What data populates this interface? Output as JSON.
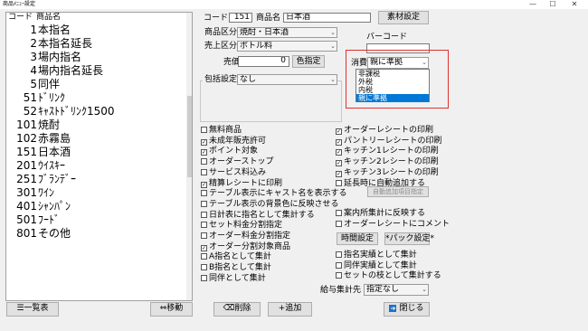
{
  "window": {
    "title": "商品ﾒﾆｭｰ設定",
    "min": "—",
    "max": "☐",
    "close": "✕"
  },
  "list": {
    "header_code": "コード",
    "header_name": "商品名",
    "rows": [
      {
        "code": "1",
        "name": "本指名"
      },
      {
        "code": "2",
        "name": "本指名延長"
      },
      {
        "code": "3",
        "name": "場内指名"
      },
      {
        "code": "4",
        "name": "場内指名延長"
      },
      {
        "code": "5",
        "name": "同伴"
      },
      {
        "code": "51",
        "name": "ﾄﾞﾘﾝｸ"
      },
      {
        "code": "52",
        "name": "ｷｬｽﾄﾄﾞﾘﾝｸ1500"
      },
      {
        "code": "101",
        "name": "焼酎"
      },
      {
        "code": "102",
        "name": "赤霧島"
      },
      {
        "code": "151",
        "name": "日本酒"
      },
      {
        "code": "201",
        "name": "ｳｲｽｷｰ"
      },
      {
        "code": "251",
        "name": "ﾌﾞﾗﾝﾃﾞｰ"
      },
      {
        "code": "301",
        "name": "ﾜｲﾝ"
      },
      {
        "code": "401",
        "name": "ｼｬﾝﾊﾟﾝ"
      },
      {
        "code": "501",
        "name": "ﾌｰﾄﾞ"
      },
      {
        "code": "801",
        "name": "その他"
      }
    ]
  },
  "form": {
    "code_label": "コード",
    "code_value": "151",
    "name_label": "商品名",
    "name_value": "日本酒",
    "material_button": "素材設定",
    "category_label": "商品区分",
    "category_value": "焼酎・日本酒",
    "sales_label": "売上区分",
    "sales_value": "ボトル料",
    "barcode_label": "バーコード",
    "barcode_value": "",
    "price_label": "売価",
    "price_value": "0",
    "color_button": "色指定",
    "tax_label": "消費税",
    "tax_value": "親に準拠",
    "tax_options": [
      "非課税",
      "外税",
      "内税",
      "親に準拠"
    ],
    "package_label": "包括設定",
    "package_value": "なし"
  },
  "checks_left": [
    {
      "label": "無料商品",
      "checked": false
    },
    {
      "label": "未成年販売許可",
      "checked": true
    },
    {
      "label": "ポイント対象",
      "checked": true
    },
    {
      "label": "オーダーストップ",
      "checked": false
    },
    {
      "label": "サービス料込み",
      "checked": false
    },
    {
      "label": "精算レシートに印刷",
      "checked": true
    },
    {
      "label": "テーブル表示にキャスト名を表示する",
      "checked": false
    },
    {
      "label": "テーブル表示の背景色に反映させる",
      "checked": false
    },
    {
      "label": "日計表に指名として集計する",
      "checked": false
    },
    {
      "label": "セット料金分割指定",
      "checked": false
    },
    {
      "label": "オーダー料金分割指定",
      "checked": false
    },
    {
      "label": "オーダー分割対象商品",
      "checked": true
    },
    {
      "label": "A指名として集計",
      "checked": false
    },
    {
      "label": "B指名として集計",
      "checked": false
    },
    {
      "label": "同伴として集計",
      "checked": false
    }
  ],
  "checks_right_top": [
    {
      "label": "オーダーレシートの印刷",
      "checked": true
    },
    {
      "label": "パントリーレシートの印刷",
      "checked": true
    },
    {
      "label": "キッチン1レシートの印刷",
      "checked": true
    },
    {
      "label": "キッチン2レシートの印刷",
      "checked": true
    },
    {
      "label": "キッチン3レシートの印刷",
      "checked": true
    },
    {
      "label": "延長時に自動追加する",
      "checked": false
    }
  ],
  "auto_add_button": "自動追加項目指定",
  "checks_right_mid": [
    {
      "label": "案内所集計に反映する",
      "checked": false
    },
    {
      "label": "オーダーレシートにコメント",
      "checked": false
    }
  ],
  "time_button": "時間設定",
  "pack_button": "*パック設定*",
  "checks_right_bottom": [
    {
      "label": "指名実績として集計",
      "checked": false
    },
    {
      "label": "同伴実績として集計",
      "checked": false
    },
    {
      "label": "セットの枝として集計する",
      "checked": false
    }
  ],
  "salary": {
    "label": "給与集計先",
    "value": "指定なし"
  },
  "bottom": {
    "list_button": "一覧表",
    "move_button": "移動",
    "delete_button": "削除",
    "add_button": "追加",
    "close_button": "閉じる"
  }
}
